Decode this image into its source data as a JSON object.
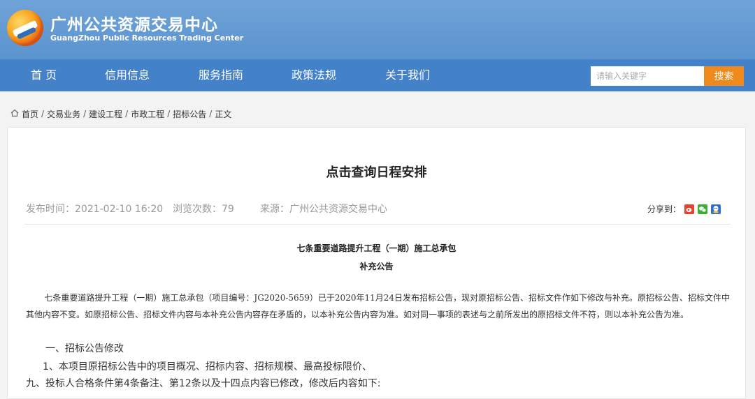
{
  "header": {
    "title": "广州公共资源交易中心",
    "subtitle": "GuangZhou Public Resources Trading Center"
  },
  "nav": {
    "items": [
      "首 页",
      "信用信息",
      "服务指南",
      "政策法规",
      "关于我们"
    ],
    "search_placeholder": "请输入关键字",
    "search_button": "搜索"
  },
  "breadcrumb": [
    "首页",
    "交易业务",
    "建设工程",
    "市政工程",
    "招标公告",
    "正文"
  ],
  "article": {
    "title": "点击查询日程安排",
    "publish_time": "发布时间：2021-02-10 16:20",
    "views": "浏览次数：79",
    "source": "来源：广州公共资源交易中心",
    "share_label": "分享到：",
    "sub_title_1": "七条重要道路提升工程（一期）施工总承包",
    "sub_title_2": "补充公告",
    "paragraph": "七条重要道路提升工程（一期）施工总承包（项目编号：JG2020-5659）已于2020年11月24日发布招标公告，现对原招标公告、招标文件作如下修改与补充。原招标公告、招标文件中其他内容不变。如原招标公告、招标文件内容与本补充公告内容存在矛盾的，以本补充公告内容为准。如对同一事项的表述与之前所发出的原招标文件不符，则以本补充公告为准。",
    "section_1": "一、招标公告修改",
    "item_1": "1、本项目原招标公告中的项目概况、招标内容、招标规模、最高投标限价、",
    "item_2": "九、投标人合格条件第4条备注、第12条以及十四点内容已修改，修改后内容如下:"
  },
  "colors": {
    "header_bg": "#5b93cf",
    "nav_bg": "#4381c8",
    "search_button": "#f08a1c"
  },
  "icons": {
    "share": [
      "weibo-icon",
      "wechat-icon",
      "qq-icon"
    ]
  }
}
